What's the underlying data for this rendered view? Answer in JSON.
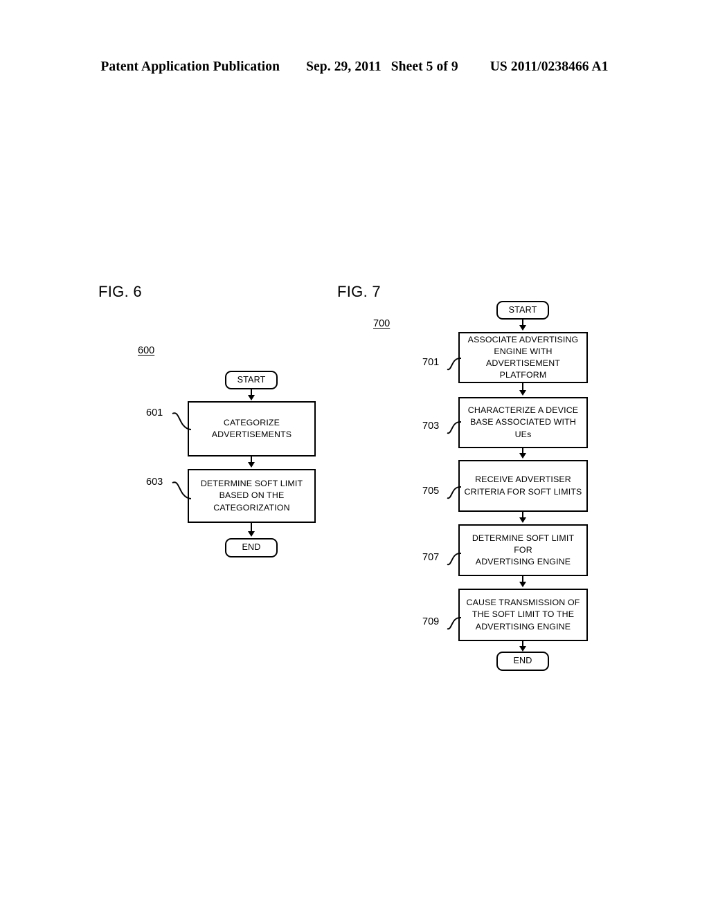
{
  "header": {
    "publication": "Patent Application Publication",
    "date": "Sep. 29, 2011",
    "sheet": "Sheet 5 of 9",
    "number": "US 2011/0238466 A1"
  },
  "figures": [
    {
      "label": "FIG. 6",
      "ref": "600",
      "nodes": [
        {
          "id": "fig6-start",
          "type": "terminal",
          "text": "START"
        },
        {
          "id": "fig6-step-601",
          "type": "process",
          "callout": "601",
          "text": "CATEGORIZE\nADVERTISEMENTS"
        },
        {
          "id": "fig6-step-603",
          "type": "process",
          "callout": "603",
          "text": "DETERMINE SOFT LIMIT\nBASED ON THE\nCATEGORIZATION"
        },
        {
          "id": "fig6-end",
          "type": "terminal",
          "text": "END"
        }
      ]
    },
    {
      "label": "FIG. 7",
      "ref": "700",
      "nodes": [
        {
          "id": "fig7-start",
          "type": "terminal",
          "text": "START"
        },
        {
          "id": "fig7-step-701",
          "type": "process",
          "callout": "701",
          "text": "ASSOCIATE ADVERTISING\nENGINE WITH\nADVERTISEMENT PLATFORM"
        },
        {
          "id": "fig7-step-703",
          "type": "process",
          "callout": "703",
          "text": "CHARACTERIZE A DEVICE\nBASE ASSOCIATED WITH UEs"
        },
        {
          "id": "fig7-step-705",
          "type": "process",
          "callout": "705",
          "text": "RECEIVE ADVERTISER\nCRITERIA FOR SOFT LIMITS"
        },
        {
          "id": "fig7-step-707",
          "type": "process",
          "callout": "707",
          "text": "DETERMINE SOFT LIMIT FOR\nADVERTISING ENGINE"
        },
        {
          "id": "fig7-step-709",
          "type": "process",
          "callout": "709",
          "text": "CAUSE TRANSMISSION OF\nTHE SOFT LIMIT TO THE\nADVERTISING ENGINE"
        },
        {
          "id": "fig7-end",
          "type": "terminal",
          "text": "END"
        }
      ]
    }
  ],
  "fig6": {
    "label": "FIG. 6",
    "ref": "600",
    "start": "START",
    "step601_num": "601",
    "step601": "CATEGORIZE\nADVERTISEMENTS",
    "step603_num": "603",
    "step603": "DETERMINE SOFT LIMIT\nBASED ON THE\nCATEGORIZATION",
    "end": "END"
  },
  "fig7": {
    "label": "FIG. 7",
    "ref": "700",
    "start": "START",
    "step701_num": "701",
    "step701": "ASSOCIATE ADVERTISING\nENGINE WITH\nADVERTISEMENT PLATFORM",
    "step703_num": "703",
    "step703": "CHARACTERIZE A DEVICE\nBASE ASSOCIATED WITH UEs",
    "step705_num": "705",
    "step705": "RECEIVE ADVERTISER\nCRITERIA FOR SOFT LIMITS",
    "step707_num": "707",
    "step707": "DETERMINE SOFT LIMIT FOR\nADVERTISING ENGINE",
    "step709_num": "709",
    "step709": "CAUSE TRANSMISSION OF\nTHE SOFT LIMIT TO THE\nADVERTISING ENGINE",
    "end": "END"
  },
  "colors": {
    "ink": "#000000",
    "page": "#ffffff"
  }
}
